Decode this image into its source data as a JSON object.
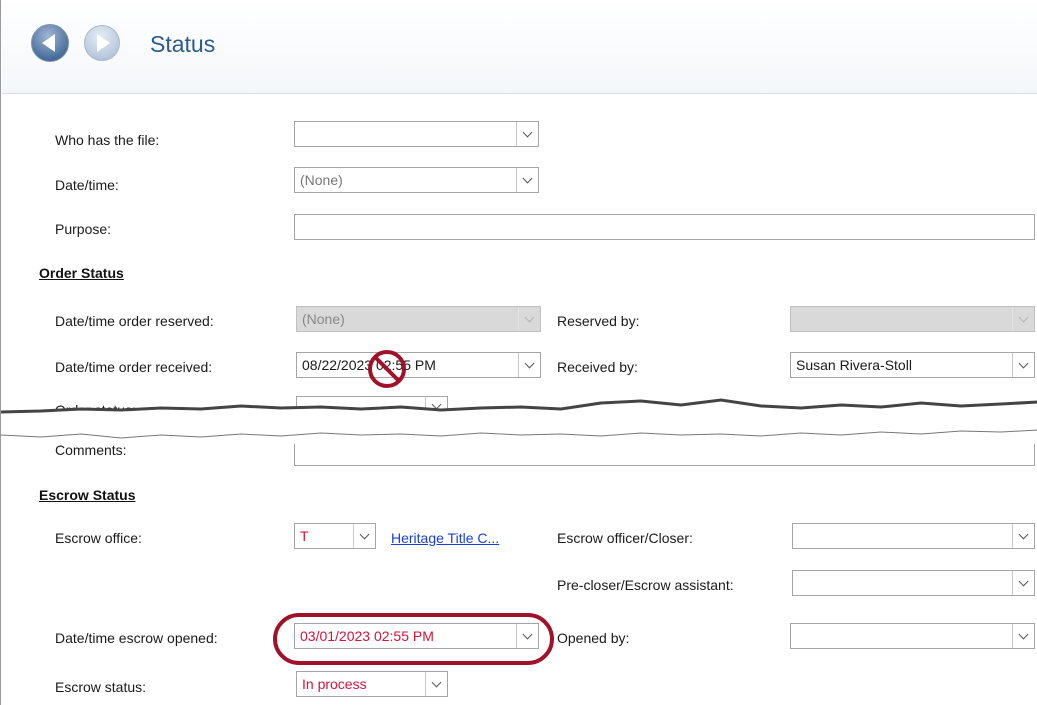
{
  "header": {
    "title": "Status",
    "back_icon": "back-arrow-icon",
    "forward_icon": "forward-arrow-icon"
  },
  "fields": {
    "who_has_file": {
      "label": "Who has the file:",
      "value": ""
    },
    "date_time": {
      "label": "Date/time:",
      "value": "(None)"
    },
    "purpose": {
      "label": "Purpose:",
      "value": ""
    }
  },
  "order_status": {
    "heading": "Order Status",
    "reserved": {
      "label": "Date/time order reserved:",
      "value": "(None)"
    },
    "reserved_by": {
      "label": "Reserved by:",
      "value": ""
    },
    "received": {
      "label": "Date/time order received:",
      "value": "08/22/2023 02:55 PM"
    },
    "received_by": {
      "label": "Received by:",
      "value": "Susan Rivera-Stoll"
    },
    "order_status": {
      "label": "Order status:",
      "value": ""
    },
    "comments": {
      "label": "Comments:",
      "value": ""
    }
  },
  "escrow_status": {
    "heading": "Escrow Status",
    "office": {
      "label": "Escrow office:",
      "value": "T",
      "link": "Heritage Title C..."
    },
    "officer": {
      "label": "Escrow officer/Closer:",
      "value": ""
    },
    "pre_closer": {
      "label": "Pre-closer/Escrow assistant:",
      "value": ""
    },
    "opened": {
      "label": "Date/time escrow opened:",
      "value": "03/01/2023 02:55 PM"
    },
    "opened_by": {
      "label": "Opened by:",
      "value": ""
    },
    "status": {
      "label": "Escrow status:",
      "value": "In process"
    }
  },
  "colors": {
    "title": "#2a5b92",
    "error_text": "#d0153a",
    "highlight": "#a0122a",
    "link": "#1a3fd4"
  }
}
